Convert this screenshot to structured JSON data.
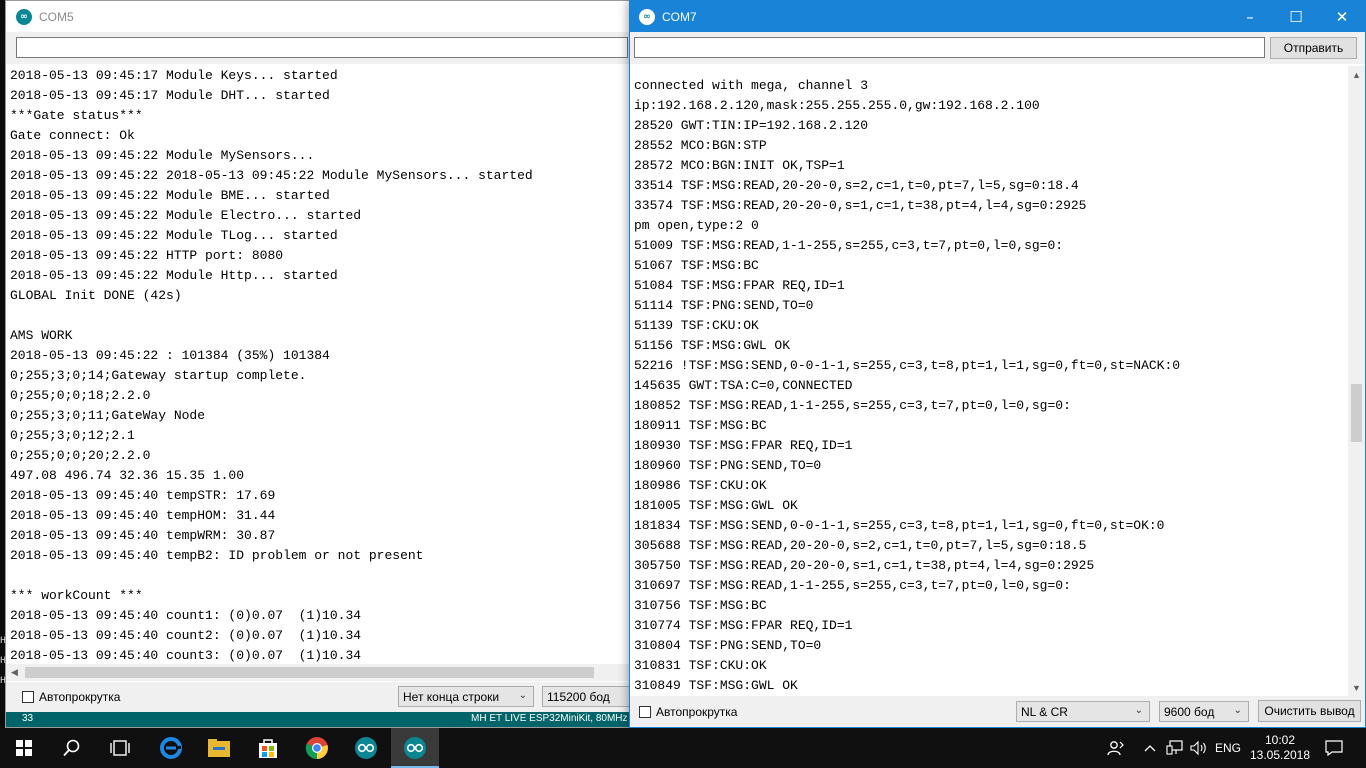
{
  "window_com5": {
    "title": "COM5",
    "lines": [
      "2018-05-13 09:45:17 Module Keys... started",
      "2018-05-13 09:45:17 Module DHT... started",
      "***Gate status***",
      "Gate connect: Ok",
      "2018-05-13 09:45:22 Module MySensors...",
      "2018-05-13 09:45:22 2018-05-13 09:45:22 Module MySensors... started",
      "2018-05-13 09:45:22 Module BME... started",
      "2018-05-13 09:45:22 Module Electro... started",
      "2018-05-13 09:45:22 Module TLog... started",
      "2018-05-13 09:45:22 HTTP port: 8080",
      "2018-05-13 09:45:22 Module Http... started",
      "GLOBAL Init DONE (42s)",
      "",
      "AMS WORK",
      "2018-05-13 09:45:22 : 101384 (35%) 101384",
      "0;255;3;0;14;Gateway startup complete.",
      "0;255;0;0;18;2.2.0",
      "0;255;3;0;11;GateWay Node",
      "0;255;3;0;12;2.1",
      "0;255;0;0;20;2.2.0",
      "497.08 496.74 32.36 15.35 1.00",
      "2018-05-13 09:45:40 tempSTR: 17.69",
      "2018-05-13 09:45:40 tempHOM: 31.44",
      "2018-05-13 09:45:40 tempWRM: 30.87",
      "2018-05-13 09:45:40 tempB2: ID problem or not present",
      "",
      "*** workCount ***",
      "2018-05-13 09:45:40 count1: (0)0.07  (1)10.34",
      "2018-05-13 09:45:40 count2: (0)0.07  (1)10.34",
      "2018-05-13 09:45:40 count3: (0)0.07  (1)10.34"
    ],
    "autoscroll_label": "Автопрокрутка",
    "autoscroll_checked": false,
    "line_ending": "Нет конца строки",
    "baud": "115200 бод",
    "status_line_number": "33",
    "status_board": "MH ET LIVE ESP32MiniKit, 80MHz"
  },
  "window_com7": {
    "title": "COM7",
    "send_label": "Отправить",
    "send_value": "",
    "lines": [
      "connected with mega, channel 3",
      "ip:192.168.2.120,mask:255.255.255.0,gw:192.168.2.100",
      "28520 GWT:TIN:IP=192.168.2.120",
      "28552 MCO:BGN:STP",
      "28572 MCO:BGN:INIT OK,TSP=1",
      "33514 TSF:MSG:READ,20-20-0,s=2,c=1,t=0,pt=7,l=5,sg=0:18.4",
      "33574 TSF:MSG:READ,20-20-0,s=1,c=1,t=38,pt=4,l=4,sg=0:2925",
      "pm open,type:2 0",
      "51009 TSF:MSG:READ,1-1-255,s=255,c=3,t=7,pt=0,l=0,sg=0:",
      "51067 TSF:MSG:BC",
      "51084 TSF:MSG:FPAR REQ,ID=1",
      "51114 TSF:PNG:SEND,TO=0",
      "51139 TSF:CKU:OK",
      "51156 TSF:MSG:GWL OK",
      "52216 !TSF:MSG:SEND,0-0-1-1,s=255,c=3,t=8,pt=1,l=1,sg=0,ft=0,st=NACK:0",
      "145635 GWT:TSA:C=0,CONNECTED",
      "180852 TSF:MSG:READ,1-1-255,s=255,c=3,t=7,pt=0,l=0,sg=0:",
      "180911 TSF:MSG:BC",
      "180930 TSF:MSG:FPAR REQ,ID=1",
      "180960 TSF:PNG:SEND,TO=0",
      "180986 TSF:CKU:OK",
      "181005 TSF:MSG:GWL OK",
      "181834 TSF:MSG:SEND,0-0-1-1,s=255,c=3,t=8,pt=1,l=1,sg=0,ft=0,st=OK:0",
      "305688 TSF:MSG:READ,20-20-0,s=2,c=1,t=0,pt=7,l=5,sg=0:18.5",
      "305750 TSF:MSG:READ,20-20-0,s=1,c=1,t=38,pt=4,l=4,sg=0:2925",
      "310697 TSF:MSG:READ,1-1-255,s=255,c=3,t=7,pt=0,l=0,sg=0:",
      "310756 TSF:MSG:BC",
      "310774 TSF:MSG:FPAR REQ,ID=1",
      "310804 TSF:PNG:SEND,TO=0",
      "310831 TSF:CKU:OK",
      "310849 TSF:MSG:GWL OK"
    ],
    "autoscroll_label": "Автопрокрутка",
    "autoscroll_checked": false,
    "line_ending": "NL & CR",
    "baud": "9600 бод",
    "clear_label": "Очистить вывод"
  },
  "behind_window_chars": [
    "H",
    "H",
    "H"
  ],
  "taskbar": {
    "language": "ENG",
    "time": "10:02",
    "date": "13.05.2018",
    "apps": [
      "start-icon",
      "search-icon",
      "task-view-icon",
      "edge-icon",
      "file-explorer-icon",
      "store-icon",
      "chrome-icon",
      "arduino-icon",
      "arduino-icon"
    ]
  },
  "colors": {
    "active_title": "#1883d7",
    "arduino_status": "#006468",
    "taskbar": "#101010"
  }
}
